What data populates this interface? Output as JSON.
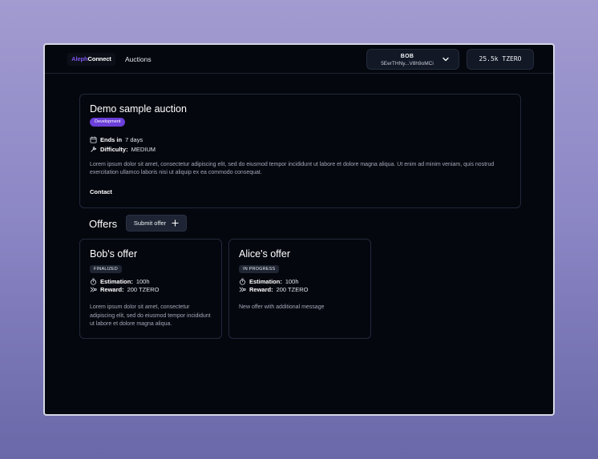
{
  "header": {
    "logo_brand": "Aleph",
    "logo_rest": "Connect",
    "nav": "Auctions",
    "account_name": "BOB",
    "account_address": "5EerTHNy...V8h9oMCi",
    "balance": "25.5k TZERO"
  },
  "auction": {
    "title": "Demo sample auction",
    "tag": "Development",
    "ends_label": "Ends in",
    "ends_value": "7 days",
    "difficulty_label": "Difficulty:",
    "difficulty_value": "MEDIUM",
    "description": "Lorem ipsum dolor sit amet, consectetur adipiscing elit, sed do eiusmod tempor incididunt ut labore et dolore magna aliqua. Ut enim ad minim veniam, quis nostrud exercitation ullamco laboris nisi ut aliquip ex ea commodo consequat.",
    "contact": "Contact"
  },
  "offers": {
    "title": "Offers",
    "submit_label": "Submit offer",
    "items": [
      {
        "title": "Bob's offer",
        "status": "FINALIZED",
        "estimation_label": "Estimation:",
        "estimation_value": "100h",
        "reward_label": "Reward:",
        "reward_value": "200 TZERO",
        "description": "Lorem ipsum dolor sit amet, consectetur adipiscing elit, sed do eiusmod tempor incididunt ut labore et dolore magna aliqua."
      },
      {
        "title": "Alice's offer",
        "status": "IN PROGRESS",
        "estimation_label": "Estimation:",
        "estimation_value": "100h",
        "reward_label": "Reward:",
        "reward_value": "200 TZERO",
        "description": "New offer with additional message"
      }
    ]
  },
  "colors": {
    "background": "#05070f",
    "accent": "#6b3fd9",
    "card_border": "#22293a",
    "text_muted": "#a5a9b6"
  },
  "icons": {
    "account_toggle": "chevron-down-icon",
    "ends": "calendar-icon",
    "difficulty": "wrench-icon",
    "submit": "plus-icon",
    "estimation": "stopwatch-icon",
    "reward": "reward-icon"
  }
}
